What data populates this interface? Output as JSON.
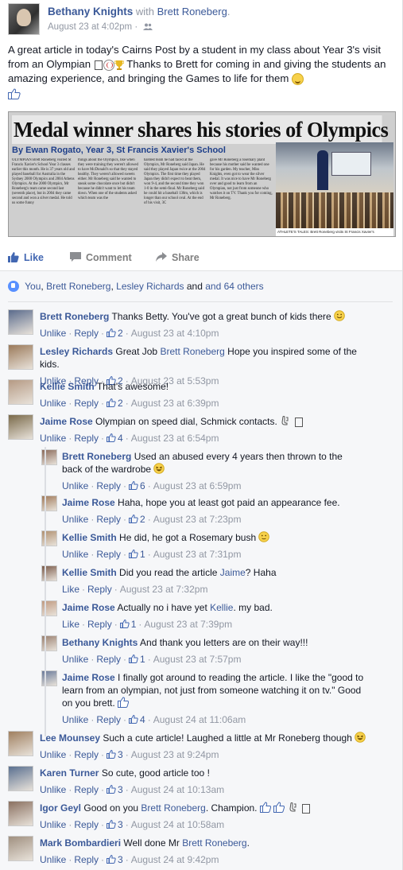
{
  "post": {
    "author": "Bethany Knights",
    "with_text": "with",
    "with_name": "Brett Roneberg",
    "with_suffix": ".",
    "timestamp": "August 23 at 4:02pm",
    "separator": "·",
    "text_1": "A great article in today's Cairns Post by a student in my class about Year 3's visit from an Olympian",
    "text_2": "Thanks to Brett for coming in and giving the students an amazing experience, and bringing the Games to life for them",
    "article": {
      "headline": "Medal winner shares his stories of Olympics",
      "byline": "By Ewan Rogato, Year 3, St Francis Xavier's School",
      "col1": "OLYMPIAN Brett Roneberg visited St Francis Xavier's School Year 3 classes earlier this month. He is 37 years old and played baseball for Australia in the Sydney 2000 Olympics and 2004 Athens Olympics. At the 2000 Olympics, Mr Roneberg's team came second last (seventh place), but in 2004 they came second and won a silver medal. He told us some funny",
      "col2": "things about the Olympics, like when they were training they weren't allowed to have McDonald's so that they stayed healthy. They weren't allowed sweets either. Mr Roneberg said he wanted to sneak some chocolate once but didn't because he didn't want to let his team down. When one of the students asked which team was the",
      "col3": "hardest team he had faced at the Olympics, Mr Roneberg said Japan. He said they played Japan twice at the 2004 Olympics. The first time they played Japan they didn't expect to beat them, won 9-4, and the second time they won 1-0 in the semi-final. Mr Roneberg said he could hit a baseball 130m, which is longer than our school oval. At the end of his visit, 3C",
      "col4": "gave Mr Roneberg a rosemary plant because his mother said he wanted one for his garden. My teacher, Miss Knights, even got to wear the silver medal. It was nice to have Mr Roneberg over and good to learn from an Olympian, not just from someone who watches it on TV. Thank you for coming, Mr Roneberg.",
      "caption": "ATHLETE'S TALES: Brett Roneberg visits St Francis Xavier's"
    }
  },
  "actions": {
    "like": "Like",
    "comment": "Comment",
    "share": "Share"
  },
  "likes": {
    "name1": "You",
    "sep1": ",",
    "name2": "Brett Roneberg",
    "sep2": ",",
    "name3": "Lesley Richards",
    "tail": "and 64 others"
  },
  "meta_labels": {
    "unlike": "Unlike",
    "like": "Like",
    "reply": "Reply",
    "dot": "·"
  },
  "comments": [
    {
      "name": "Brett Roneberg",
      "text": "Thanks Betty. You've got a great bunch of kids there",
      "likes": "2",
      "time": "August 23 at 4:10pm",
      "like_label": "Unlike"
    },
    {
      "name": "Lesley Richards",
      "text_a": "Great Job",
      "mention": "Brett Roneberg",
      "text_b": "Hope you inspired some of the kids.",
      "likes": "2",
      "time": "August 23 at 5:53pm",
      "like_label": "Unlike"
    },
    {
      "name": "Kellie Smith",
      "text": "That's awesome!",
      "likes": "2",
      "time": "August 23 at 6:39pm",
      "like_label": "Unlike"
    },
    {
      "name": "Jaime Rose",
      "text": "Olympian on speed dial, Schmick contacts.",
      "likes": "4",
      "time": "August 23 at 6:54pm",
      "like_label": "Unlike"
    }
  ],
  "replies": [
    {
      "name": "Brett Roneberg",
      "text": "Used an abused every 4 years then thrown to the back of the wardrobe",
      "likes": "6",
      "time": "August 23 at 6:59pm",
      "like_label": "Unlike"
    },
    {
      "name": "Jaime Rose",
      "text": "Haha, hope you at least got paid an appearance fee.",
      "likes": "2",
      "time": "August 23 at 7:23pm",
      "like_label": "Unlike"
    },
    {
      "name": "Kellie Smith",
      "text": "He did, he got a Rosemary bush",
      "likes": "1",
      "time": "August 23 at 7:31pm",
      "like_label": "Unlike"
    },
    {
      "name": "Kellie Smith",
      "text_a": "Did you read the article",
      "mention": "Jaime",
      "text_b": "? Haha",
      "likes": "",
      "time": "August 23 at 7:32pm",
      "like_label": "Like"
    },
    {
      "name": "Jaime Rose",
      "text_a": "Actually no i have yet",
      "mention": "Kellie",
      "text_b": ". my bad.",
      "likes": "1",
      "time": "August 23 at 7:39pm",
      "like_label": "Like"
    },
    {
      "name": "Bethany Knights",
      "text": "And thank you letters are on their way!!!",
      "likes": "1",
      "time": "August 23 at 7:57pm",
      "like_label": "Unlike"
    },
    {
      "name": "Jaime Rose",
      "text": "I finally got around to reading the article. I like the \"good to learn from an olympian, not just from someone watching it on tv.\" Good on you brett.",
      "likes": "4",
      "time": "August 24 at 11:06am",
      "like_label": "Unlike"
    }
  ],
  "comments_after": [
    {
      "name": "Lee Mounsey",
      "text": "Such a cute article! Laughed a little at Mr Roneberg though",
      "likes": "3",
      "time": "August 23 at 9:24pm",
      "like_label": "Unlike"
    },
    {
      "name": "Karen Turner",
      "text": "So cute, good article too !",
      "likes": "3",
      "time": "August 24 at 10:13am",
      "like_label": "Unlike"
    },
    {
      "name": "Igor Geyl",
      "text_a": "Good on you",
      "mention": "Brett Roneberg",
      "text_b": ". Champion.",
      "likes": "3",
      "time": "August 24 at 10:58am",
      "like_label": "Unlike"
    },
    {
      "name": "Mark Bombardieri",
      "text_a": "Well done Mr",
      "mention": "Brett Roneberg",
      "text_b": ".",
      "likes": "3",
      "time": "August 24 at 9:42pm",
      "like_label": "Unlike"
    }
  ],
  "colors": {
    "link": "#3b5998",
    "like_action": "#4267b2",
    "muted": "#9197a3",
    "ufi_bg": "#f6f7f9"
  }
}
